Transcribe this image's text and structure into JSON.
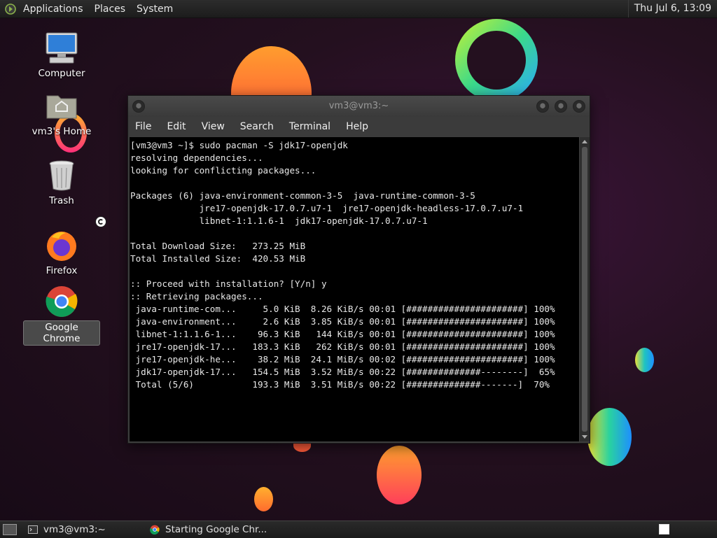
{
  "top_panel": {
    "menus": [
      "Applications",
      "Places",
      "System"
    ],
    "clock": "Thu Jul  6, 13:09"
  },
  "desktop": {
    "icons": [
      {
        "label": "Computer",
        "icon": "computer-icon"
      },
      {
        "label": "vm3's Home",
        "icon": "home-folder-icon"
      },
      {
        "label": "Trash",
        "icon": "trash-icon"
      },
      {
        "label": "Firefox",
        "icon": "firefox-icon"
      },
      {
        "label": "Google Chrome",
        "icon": "chrome-icon",
        "selected": true
      }
    ]
  },
  "terminal": {
    "title": "vm3@vm3:~",
    "menus": [
      "File",
      "Edit",
      "View",
      "Search",
      "Terminal",
      "Help"
    ],
    "lines": [
      "[vm3@vm3 ~]$ sudo pacman -S jdk17-openjdk",
      "resolving dependencies...",
      "looking for conflicting packages...",
      "",
      "Packages (6) java-environment-common-3-5  java-runtime-common-3-5",
      "             jre17-openjdk-17.0.7.u7-1  jre17-openjdk-headless-17.0.7.u7-1",
      "             libnet-1:1.1.6-1  jdk17-openjdk-17.0.7.u7-1",
      "",
      "Total Download Size:   273.25 MiB",
      "Total Installed Size:  420.53 MiB",
      "",
      ":: Proceed with installation? [Y/n] y",
      ":: Retrieving packages...",
      " java-runtime-com...     5.0 KiB  8.26 KiB/s 00:01 [######################] 100%",
      " java-environment...     2.6 KiB  3.85 KiB/s 00:01 [######################] 100%",
      " libnet-1:1.1.6-1...    96.3 KiB   144 KiB/s 00:01 [######################] 100%",
      " jre17-openjdk-17...   183.3 KiB   262 KiB/s 00:01 [######################] 100%",
      " jre17-openjdk-he...    38.2 MiB  24.1 MiB/s 00:02 [######################] 100%",
      " jdk17-openjdk-17...   154.5 MiB  3.52 MiB/s 00:22 [##############--------]  65%",
      " Total (5/6)           193.3 MiB  3.51 MiB/s 00:22 [##############-------]  70%"
    ]
  },
  "taskbar": {
    "tasks": [
      {
        "label": "vm3@vm3:~",
        "icon": "terminal-icon"
      },
      {
        "label": "Starting Google Chr...",
        "icon": "chrome-icon"
      }
    ]
  }
}
